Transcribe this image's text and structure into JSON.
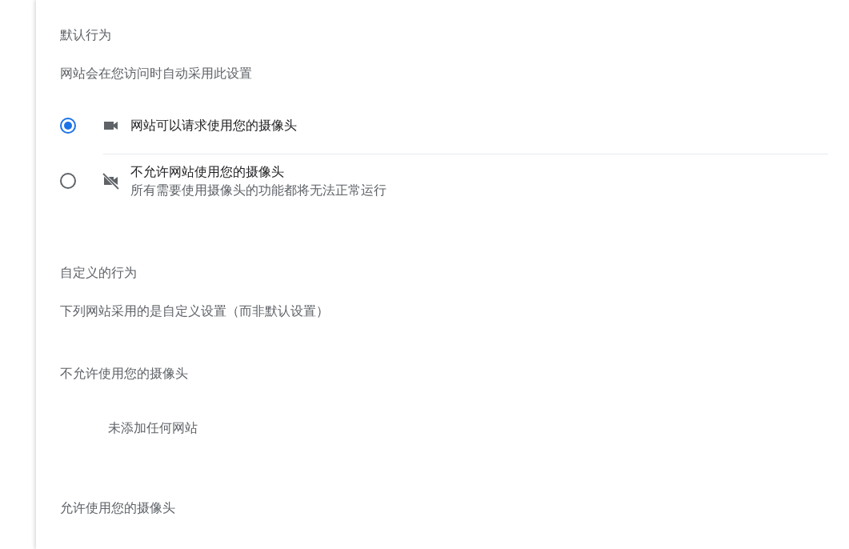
{
  "default_behavior": {
    "heading": "默认行为",
    "description": "网站会在您访问时自动采用此设置",
    "options": [
      {
        "kind": "allow",
        "label": "网站可以请求使用您的摄像头",
        "selected": true
      },
      {
        "kind": "block",
        "label": "不允许网站使用您的摄像头",
        "sublabel": "所有需要使用摄像头的功能都将无法正常运行",
        "selected": false
      }
    ]
  },
  "custom_behavior": {
    "heading": "自定义的行为",
    "description": "下列网站采用的是自定义设置（而非默认设置）",
    "lists": [
      {
        "heading": "不允许使用您的摄像头",
        "empty_text": "未添加任何网站"
      },
      {
        "heading": "允许使用您的摄像头"
      }
    ]
  }
}
